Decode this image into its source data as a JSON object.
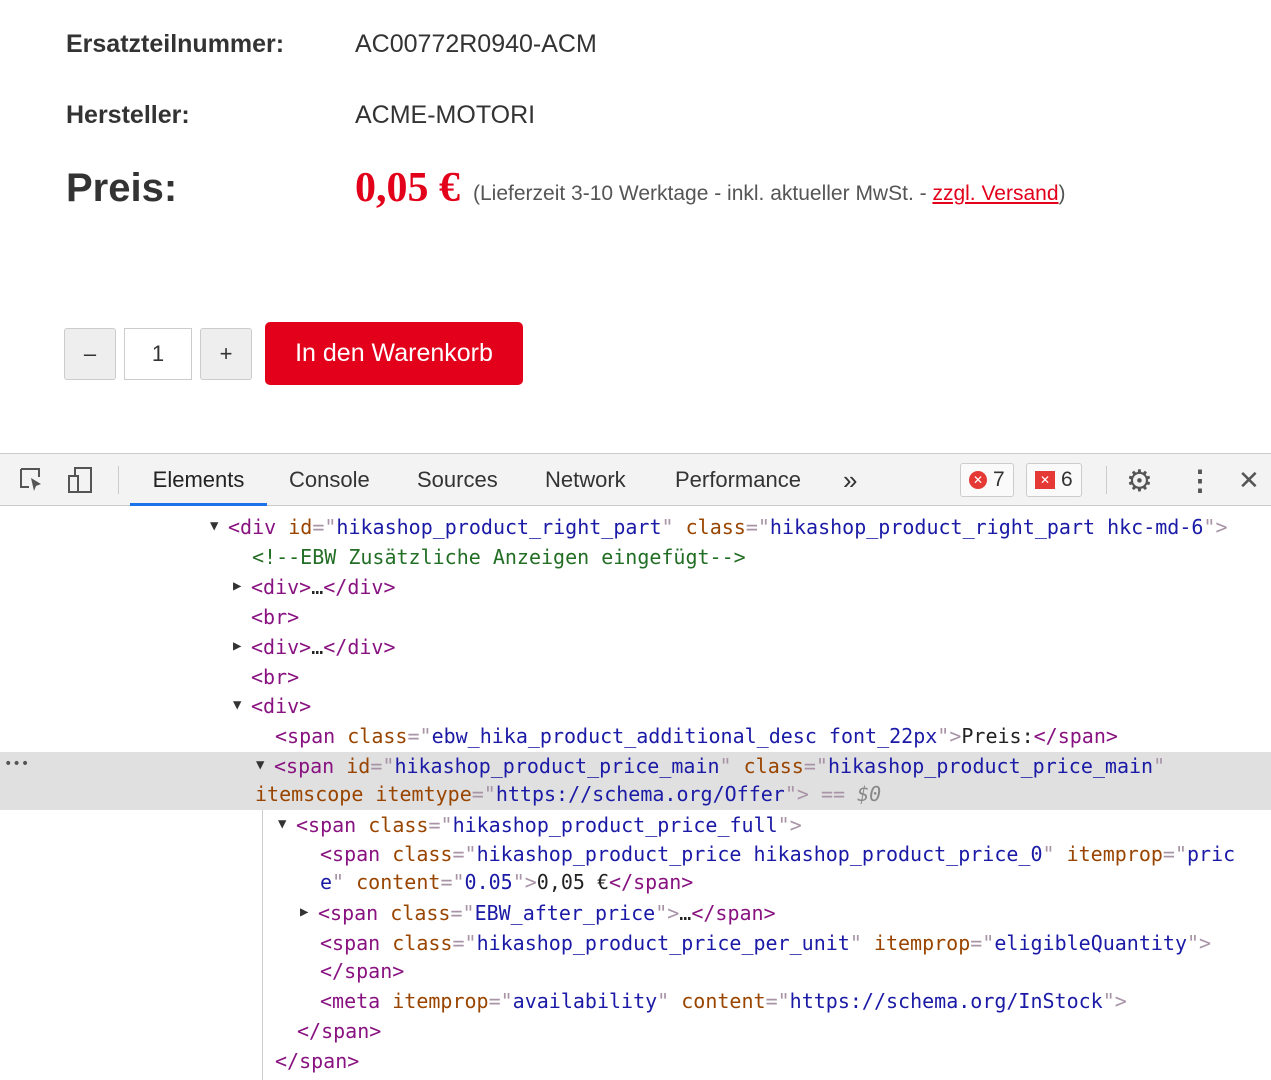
{
  "product": {
    "part_label": "Ersatzteilnummer:",
    "part_value": "AC00772R0940-ACM",
    "maker_label": "Hersteller:",
    "maker_value": "ACME-MOTORI",
    "price_label": "Preis:",
    "price": "0,05 €",
    "note_pre": "(Lieferzeit 3-10 Werktage - inkl. aktueller MwSt. - ",
    "note_link": "zzgl. Versand",
    "note_post": ")"
  },
  "cart": {
    "minus": "–",
    "qty": "1",
    "plus": "+",
    "add": "In den Warenkorb"
  },
  "devtools": {
    "tabs": [
      "Elements",
      "Console",
      "Sources",
      "Network",
      "Performance"
    ],
    "more": "»",
    "errors": "7",
    "warnings": "6",
    "close": "✕",
    "dots": "⋮",
    "ellipsis": "•••",
    "lines": [
      [
        [
          "t",
          "<div "
        ],
        [
          "a",
          "id"
        ],
        [
          "p",
          "=\""
        ],
        [
          "v",
          "hikashop_product_right_part"
        ],
        [
          "p",
          "\" "
        ],
        [
          "a",
          "class"
        ],
        [
          "p",
          "=\""
        ],
        [
          "v",
          "hikashop_product_right_part hkc-md-6"
        ],
        [
          "p",
          "\">"
        ]
      ],
      [
        [
          "c",
          "<!--EBW Zusätzliche Anzeigen eingefügt-->"
        ]
      ],
      [
        [
          "t",
          "<div>"
        ],
        [
          "x",
          "…"
        ],
        [
          "t",
          "</div>"
        ]
      ],
      [
        [
          "t",
          "<br>"
        ]
      ],
      [
        [
          "t",
          "<div>"
        ],
        [
          "x",
          "…"
        ],
        [
          "t",
          "</div>"
        ]
      ],
      [
        [
          "t",
          "<br>"
        ]
      ],
      [
        [
          "t",
          "<div>"
        ]
      ],
      [
        [
          "t",
          "<span "
        ],
        [
          "a",
          "class"
        ],
        [
          "p",
          "=\""
        ],
        [
          "v",
          "ebw_hika_product_additional_desc font_22px"
        ],
        [
          "p",
          "\">"
        ],
        [
          "x",
          "Preis:"
        ],
        [
          "t",
          "</span>"
        ]
      ],
      [
        [
          "t",
          "<span "
        ],
        [
          "a",
          "id"
        ],
        [
          "p",
          "=\""
        ],
        [
          "v",
          "hikashop_product_price_main"
        ],
        [
          "p",
          "\" "
        ],
        [
          "a",
          "class"
        ],
        [
          "p",
          "=\""
        ],
        [
          "v",
          "hikashop_product_price_main"
        ],
        [
          "p",
          "\""
        ]
      ],
      [
        [
          "a",
          "itemscope itemtype"
        ],
        [
          "p",
          "=\""
        ],
        [
          "v",
          "https://schema.org/Offer"
        ],
        [
          "p",
          "\">"
        ],
        [
          "p",
          " == "
        ],
        [
          "d",
          "$0"
        ]
      ],
      [
        [
          "t",
          "<span "
        ],
        [
          "a",
          "class"
        ],
        [
          "p",
          "=\""
        ],
        [
          "v",
          "hikashop_product_price_full"
        ],
        [
          "p",
          "\">"
        ]
      ],
      [
        [
          "t",
          "<span "
        ],
        [
          "a",
          "class"
        ],
        [
          "p",
          "=\""
        ],
        [
          "v",
          "hikashop_product_price hikashop_product_price_0"
        ],
        [
          "p",
          "\" "
        ],
        [
          "a",
          "itemprop"
        ],
        [
          "p",
          "=\""
        ],
        [
          "v",
          "pric"
        ]
      ],
      [
        [
          "v",
          "e"
        ],
        [
          "p",
          "\" "
        ],
        [
          "a",
          "content"
        ],
        [
          "p",
          "=\""
        ],
        [
          "v",
          "0.05"
        ],
        [
          "p",
          "\">"
        ],
        [
          "x",
          "0,05 €"
        ],
        [
          "t",
          "</span>"
        ]
      ],
      [
        [
          "t",
          "<span "
        ],
        [
          "a",
          "class"
        ],
        [
          "p",
          "=\""
        ],
        [
          "v",
          "EBW_after_price"
        ],
        [
          "p",
          "\">"
        ],
        [
          "x",
          "…"
        ],
        [
          "t",
          "</span>"
        ]
      ],
      [
        [
          "t",
          "<span "
        ],
        [
          "a",
          "class"
        ],
        [
          "p",
          "=\""
        ],
        [
          "v",
          "hikashop_product_price_per_unit"
        ],
        [
          "p",
          "\" "
        ],
        [
          "a",
          "itemprop"
        ],
        [
          "p",
          "=\""
        ],
        [
          "v",
          "eligibleQuantity"
        ],
        [
          "p",
          "\">"
        ]
      ],
      [
        [
          "t",
          "</span>"
        ]
      ],
      [
        [
          "t",
          "<meta "
        ],
        [
          "a",
          "itemprop"
        ],
        [
          "p",
          "=\""
        ],
        [
          "v",
          "availability"
        ],
        [
          "p",
          "\" "
        ],
        [
          "a",
          "content"
        ],
        [
          "p",
          "=\""
        ],
        [
          "v",
          "https://schema.org/InStock"
        ],
        [
          "p",
          "\">"
        ]
      ],
      [
        [
          "t",
          "</span>"
        ]
      ],
      [
        [
          "t",
          "</span>"
        ]
      ]
    ]
  }
}
